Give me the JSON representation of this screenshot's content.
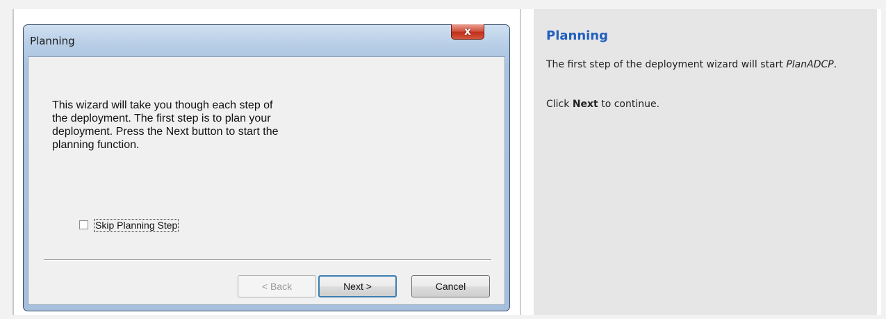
{
  "dialog": {
    "title": "Planning",
    "close_label": "x",
    "message": "This wizard will take you though each step of\nthe deployment.  The first step is to plan your\ndeployment.  Press the Next button to start the\nplanning function.",
    "skip_checkbox": {
      "label": "Skip Planning Step",
      "checked": false
    },
    "buttons": {
      "back": "< Back",
      "next": "Next >",
      "cancel": "Cancel"
    }
  },
  "help": {
    "title": "Planning",
    "para1_text": "The first step of the deployment wizard will start ",
    "para1_italic": "PlanADCP",
    "para1_end": ".",
    "para2_pre": "Click ",
    "para2_bold": "Next",
    "para2_post": " to continue."
  },
  "colors": {
    "help_title": "#1f5fbf",
    "close_button": "#c0301b",
    "dialog_frame": "#a9c3e0"
  }
}
